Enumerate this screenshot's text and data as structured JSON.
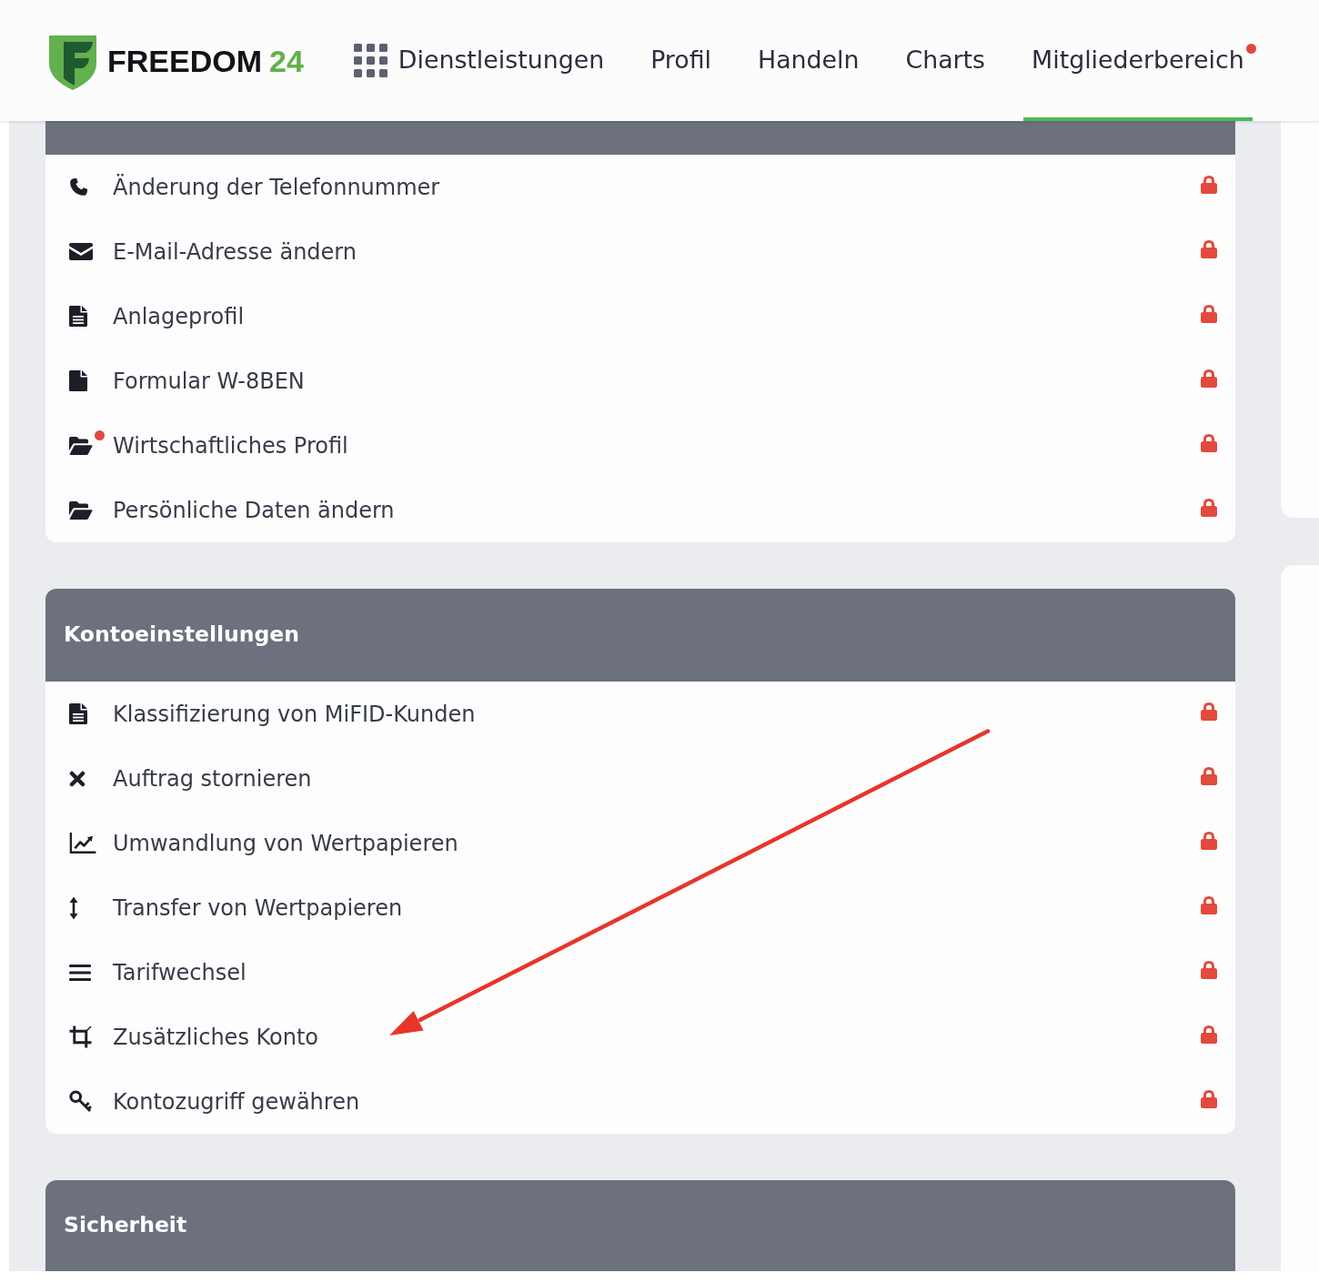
{
  "header": {
    "logo": {
      "name": "FREEDOM",
      "number": "24"
    },
    "nav": [
      {
        "label": "Dienstleistungen",
        "kind": "menu",
        "selected": false,
        "notification": false
      },
      {
        "label": "Profil",
        "kind": "link",
        "selected": false,
        "notification": false
      },
      {
        "label": "Handeln",
        "kind": "link",
        "selected": false,
        "notification": false
      },
      {
        "label": "Charts",
        "kind": "link",
        "selected": false,
        "notification": false
      },
      {
        "label": "Mitgliederbereich",
        "kind": "link",
        "selected": true,
        "notification": true
      }
    ]
  },
  "sections": [
    {
      "items": [
        {
          "label": "Änderung der Telefonnummer",
          "locked": true,
          "notification": false,
          "annotated": false
        },
        {
          "label": "E-Mail-Adresse ändern",
          "locked": true,
          "notification": false,
          "annotated": false
        },
        {
          "label": "Anlageprofil",
          "locked": true,
          "notification": false,
          "annotated": false
        },
        {
          "label": "Formular W-8BEN",
          "locked": true,
          "notification": false,
          "annotated": false
        },
        {
          "label": "Wirtschaftliches Profil",
          "locked": true,
          "notification": true,
          "annotated": false
        },
        {
          "label": "Persönliche Daten ändern",
          "locked": true,
          "notification": false,
          "annotated": false
        }
      ]
    },
    {
      "title": "Kontoeinstellungen",
      "items": [
        {
          "label": "Klassifizierung von MiFID-Kunden",
          "locked": true,
          "notification": false,
          "annotated": false
        },
        {
          "label": "Auftrag stornieren",
          "locked": true,
          "notification": false,
          "annotated": false
        },
        {
          "label": "Umwandlung von Wertpapieren",
          "locked": true,
          "notification": false,
          "annotated": false
        },
        {
          "label": "Transfer von Wertpapieren",
          "locked": true,
          "notification": false,
          "annotated": false
        },
        {
          "label": "Tarifwechsel",
          "locked": true,
          "notification": false,
          "annotated": false
        },
        {
          "label": "Zusätzliches Konto",
          "locked": true,
          "notification": false,
          "annotated": true
        },
        {
          "label": "Kontozugriff gewähren",
          "locked": true,
          "notification": false,
          "annotated": false
        }
      ]
    },
    {
      "title": "Sicherheit"
    }
  ]
}
